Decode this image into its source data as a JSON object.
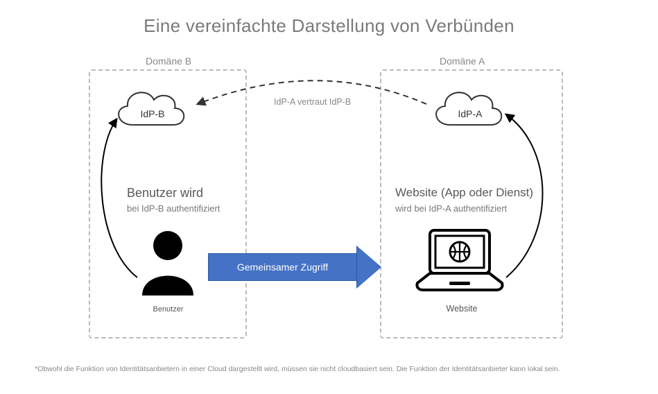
{
  "title": "Eine vereinfachte Darstellung von Verbünden",
  "domain_b_label": "Domäne B",
  "domain_a_label": "Domäne A",
  "idp_b": "IdP-B",
  "idp_a": "IdP-A",
  "trust_label": "IdP-A vertraut IdP-B",
  "user_auth_title": "Benutzer wird",
  "user_auth_sub": "bei IdP-B authentifiziert",
  "site_auth_title": "Website (App oder Dienst)",
  "site_auth_sub": "wird bei IdP-A authentifiziert",
  "shared_access": "Gemeinsamer Zugriff",
  "user_label": "Benutzer",
  "website_label": "Website",
  "footnote": "*Obwohl die Funktion von Identitätsanbietern in einer Cloud dargestellt wird, müssen sie nicht cloudbasiert sein. Die Funktion der Identitätsanbieter kann lokal sein."
}
